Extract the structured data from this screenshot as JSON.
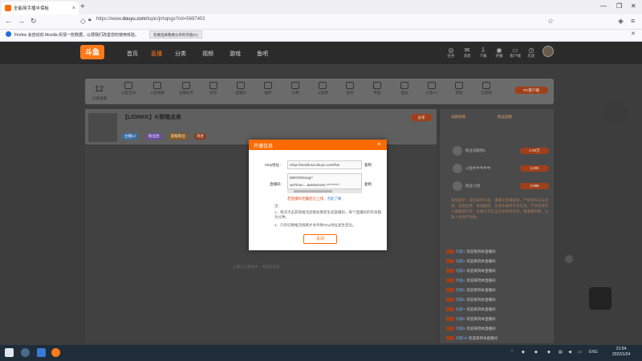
{
  "browser": {
    "tab_title": "全能简手播半保板",
    "url_prefix": "https://www.",
    "url_domain": "douyu.com",
    "url_rest": "/topic/jnhqngs?rid=5697402",
    "notice_text": "Firefox 会自动向 Mozilla 反馈一些数据，以便我们改善您的使用体验。",
    "notice_button": "答要选择我要分享的内容(C)"
  },
  "site": {
    "logo": "斗鱼",
    "nav": [
      "首页",
      "直播",
      "分类",
      "视频",
      "游戏",
      "鱼吧"
    ],
    "header_icons": [
      "任务",
      "消息",
      "下载",
      "开播",
      "客户端",
      "历史"
    ]
  },
  "categories": {
    "count": "12",
    "count_label": "分类直播",
    "items": [
      "斗鱼活动",
      "斗鱼视频",
      "主播任务",
      "好友",
      "直播间",
      "抽奖",
      "礼物",
      "斗鱼榜",
      "鱼吧",
      "专题",
      "鱼丸",
      "斗鱼TV",
      "游戏",
      "云游戏",
      "斗鱼",
      "更多"
    ],
    "pc_button": "PC客户端"
  },
  "room": {
    "title": "【LIONKK】K哥暗点来",
    "tags": [
      "主播LV",
      "粉丝团",
      "超级粉丝",
      "周星"
    ],
    "share": "分享",
    "player_tip": "主播正在直播中，请稍后观看"
  },
  "chat": {
    "tabs": [
      "贡献周榜",
      "粉丝团榜"
    ],
    "ranks": [
      {
        "name": "粉丝贡献榜1",
        "value": "1.00万"
      },
      {
        "name": "斗鱼牛牛牛牛牛",
        "value": "4,305"
      },
      {
        "name": "粉丝小团",
        "value": "2,986"
      }
    ],
    "system_message": "系统提示：欢迎来到斗鱼，请遵守直播规则，严禁发布违法违规、低俗色情、吸烟酗酒、造谣诈骗等不良信息。严禁未成年人直播或打赏，主播以不正当方式诱导打赏，需谨慎判断，以防人身财产损失。",
    "messages": [
      {
        "name": "玩家1",
        "text": "欢迎来到本直播间"
      },
      {
        "name": "玩家2",
        "text": "欢迎来到本直播间"
      },
      {
        "name": "玩家3",
        "text": "欢迎来到本直播间"
      },
      {
        "name": "玩家4",
        "text": "欢迎来到本直播间"
      },
      {
        "name": "玩家5",
        "text": "欢迎来到本直播间"
      },
      {
        "name": "玩家6",
        "text": "欢迎来到本直播间"
      },
      {
        "name": "玩家7",
        "text": "欢迎来到本直播间"
      },
      {
        "name": "玩家8",
        "text": "欢迎来到本直播间"
      },
      {
        "name": "玩家9",
        "text": "欢迎来到本直播间"
      },
      {
        "name": "玩家10",
        "text": "欢迎来到本直播间"
      },
      {
        "name": "玩家11",
        "text": "欢迎来到本直播间"
      }
    ]
  },
  "modal": {
    "title": "开播信息",
    "rtmp_label": "rtmp地址：",
    "rtmp_value": "rtmp://sendtc1a.douyu.com/live",
    "copy_label": "复制",
    "code_label": "直播码：",
    "code_value": "5697402raxg?wsTime=...&wsSecret=*********",
    "warning": "若直播码泄露后已上线，",
    "warning_link": "点此了解",
    "note_title": "注：",
    "note_1": "1、每次点击获取推流后都会重新生成直播码，每个直播码的有效期为分钟。",
    "note_2": "2、只有切换推流线路才会导致rtmp地址发生变化。",
    "ok_button": "关闭"
  },
  "taskbar": {
    "lang": "ENG",
    "time": "21:54",
    "date": "2022/1/24"
  },
  "colors": {
    "accent": "#ff6a00",
    "taskbar": "#1f2d3a"
  }
}
